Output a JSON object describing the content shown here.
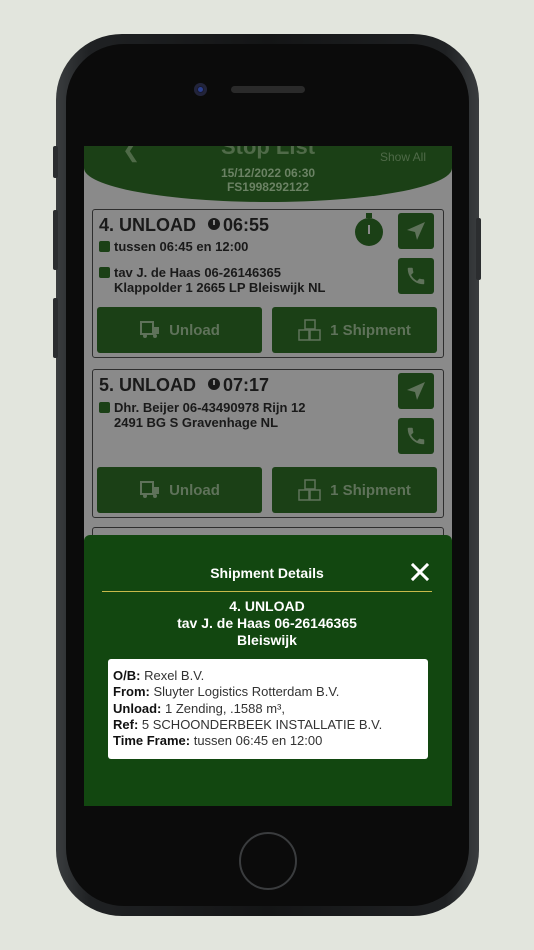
{
  "header": {
    "title": "Stop List",
    "show_all": "Show All",
    "date": "15/12/2022 06:30",
    "fs_number": "FS1998292122"
  },
  "stops": [
    {
      "title": "4. UNLOAD",
      "time": "06:55",
      "window": "tussen 06:45 en 12:00",
      "contact": "tav J. de Haas 06-26146365",
      "address": "Klappolder 1 2665 LP Bleiswijk NL",
      "unload_label": "Unload",
      "shipment_label": "1 Shipment"
    },
    {
      "title": "5. UNLOAD",
      "time": "07:17",
      "contact": "Dhr. Beijer 06-43490978 Rijn 12",
      "address": "2491 BG S Gravenhage NL",
      "unload_label": "Unload",
      "shipment_label": "1 Shipment"
    }
  ],
  "modal": {
    "title": "Shipment Details",
    "stop": "4. UNLOAD",
    "contact": "tav J. de Haas 06-26146365",
    "city": "Bleiswijk",
    "details": [
      {
        "label": "O/B:",
        "value": "Rexel B.V."
      },
      {
        "label": "From:",
        "value": "Sluyter Logistics Rotterdam B.V."
      },
      {
        "label": "Unload:",
        "value": "1 Zending, .1588 m³,"
      },
      {
        "label": "Ref:",
        "value": "5 SCHOONDERBEEK INSTALLATIE B.V."
      },
      {
        "label": "Time Frame:",
        "value": "tussen 06:45 en 12:00"
      }
    ]
  },
  "colors": {
    "brand_green": "#1b4016",
    "modal_green": "#124710",
    "rule_gold": "#c7b94a"
  }
}
